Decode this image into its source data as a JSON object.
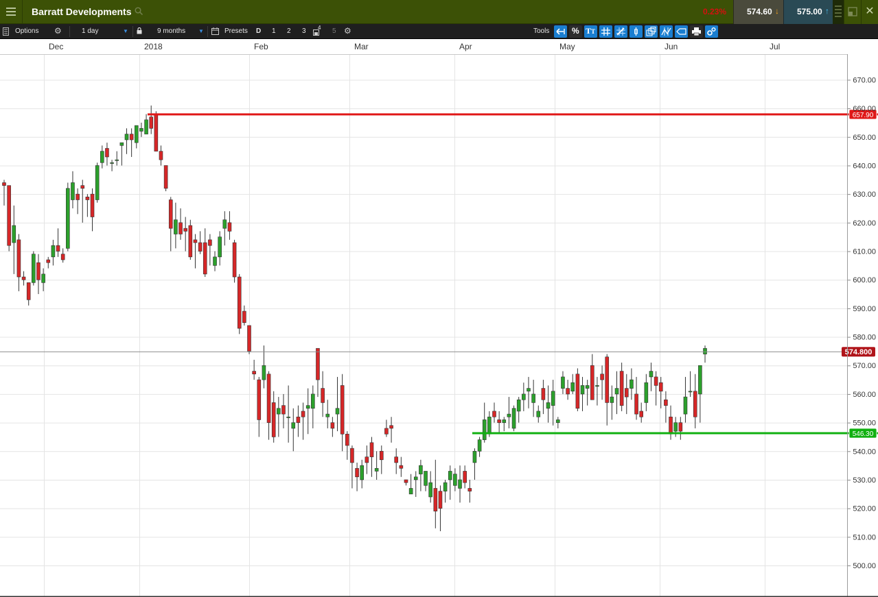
{
  "title_bar": {
    "menu_icon": "hamburger-menu-icon",
    "instrument": "Barratt Developments",
    "search_icon": "search-icon",
    "change_percent": "0.23%",
    "sell_price": "574.60",
    "buy_price": "575.00",
    "close_icon": "close-icon"
  },
  "toolbar": {
    "options_label": "Options",
    "interval": "1 day",
    "period": "9 months",
    "presets_label": "Presets",
    "preset_buttons": [
      "D",
      "1",
      "2",
      "3",
      "4",
      "5"
    ],
    "tools_label": "Tools"
  },
  "chart_data": {
    "type": "candlestick",
    "x_labels": [
      "Dec",
      "2018",
      "Feb",
      "Mar",
      "Apr",
      "May",
      "Jun",
      "Jul"
    ],
    "y_ticks": [
      "670.00",
      "660.00",
      "650.00",
      "640.00",
      "630.00",
      "620.00",
      "610.00",
      "600.00",
      "590.00",
      "580.00",
      "570.00",
      "560.00",
      "550.00",
      "540.00",
      "530.00",
      "520.00",
      "510.00",
      "500.00"
    ],
    "ylim": [
      495,
      685
    ],
    "grid": true,
    "up_color": "#2ca02c",
    "down_color": "#d62728",
    "current_price": {
      "value": 574.8,
      "label": "574.800"
    },
    "resistance": {
      "value": 657.9,
      "label": "657.90",
      "color": "#e01818"
    },
    "support": {
      "value": 546.3,
      "label": "546.30",
      "color": "#10b010"
    },
    "candles": [
      [
        634,
        635,
        626,
        633
      ],
      [
        633,
        633,
        610,
        612
      ],
      [
        613,
        626,
        602,
        619
      ],
      [
        614,
        616,
        596,
        601
      ],
      [
        601,
        603,
        598,
        600
      ],
      [
        599,
        599,
        591,
        593
      ],
      [
        599,
        610,
        598,
        609
      ],
      [
        606,
        609,
        595,
        600
      ],
      [
        599,
        604,
        596,
        602
      ],
      [
        607,
        608,
        604,
        606
      ],
      [
        608,
        614,
        605,
        612
      ],
      [
        612,
        618,
        608,
        610
      ],
      [
        609,
        611,
        606,
        607
      ],
      [
        611,
        634,
        610,
        632
      ],
      [
        628,
        638,
        625,
        634
      ],
      [
        630,
        632,
        623,
        628
      ],
      [
        633,
        635,
        620,
        632
      ],
      [
        629,
        630,
        622,
        628
      ],
      [
        630,
        632,
        617,
        622
      ],
      [
        628,
        641,
        627,
        640
      ],
      [
        641,
        647,
        639,
        645
      ],
      [
        646,
        648,
        640,
        643
      ],
      [
        641,
        642,
        638,
        641
      ],
      [
        642,
        645,
        640,
        642
      ],
      [
        647,
        647,
        640,
        648
      ],
      [
        649,
        653,
        644,
        651
      ],
      [
        651,
        653,
        643,
        649
      ],
      [
        648,
        650,
        646,
        654
      ],
      [
        652,
        655,
        650,
        653
      ],
      [
        651,
        658,
        652,
        656
      ],
      [
        657,
        661,
        651,
        653
      ],
      [
        658,
        659,
        646,
        645
      ],
      [
        645,
        647,
        640,
        642
      ],
      [
        640,
        640,
        631,
        632
      ],
      [
        628,
        629,
        610,
        618
      ],
      [
        616,
        627,
        611,
        621
      ],
      [
        620,
        625,
        614,
        616
      ],
      [
        618,
        622,
        610,
        617
      ],
      [
        619,
        621,
        607,
        608
      ],
      [
        614,
        616,
        604,
        613
      ],
      [
        613,
        617,
        609,
        610
      ],
      [
        613,
        618,
        601,
        602
      ],
      [
        614,
        616,
        605,
        612
      ],
      [
        605,
        610,
        603,
        608
      ],
      [
        608,
        617,
        605,
        615
      ],
      [
        618,
        624,
        612,
        621
      ],
      [
        620,
        624,
        614,
        617
      ],
      [
        613,
        614,
        599,
        601
      ],
      [
        601,
        602,
        581,
        583
      ],
      [
        589,
        591,
        584,
        585
      ],
      [
        584,
        584,
        574,
        575
      ],
      [
        568,
        572,
        565,
        567
      ],
      [
        565,
        566,
        545,
        551
      ],
      [
        565,
        577,
        562,
        570
      ],
      [
        567,
        568,
        544,
        550
      ],
      [
        557,
        561,
        543,
        545
      ],
      [
        553,
        559,
        545,
        555
      ],
      [
        556,
        560,
        548,
        553
      ],
      [
        552,
        563,
        543,
        552
      ],
      [
        548,
        555,
        540,
        550
      ],
      [
        552,
        556,
        545,
        550
      ],
      [
        554,
        557,
        544,
        552
      ],
      [
        555,
        562,
        546,
        556
      ],
      [
        555,
        563,
        548,
        560
      ],
      [
        576,
        576,
        559,
        565
      ],
      [
        562,
        568,
        552,
        557
      ],
      [
        552,
        558,
        548,
        553
      ],
      [
        550,
        552,
        545,
        548
      ],
      [
        553,
        566,
        547,
        555
      ],
      [
        563,
        567,
        540,
        546
      ],
      [
        546,
        547,
        537,
        542
      ],
      [
        541,
        542,
        527,
        536
      ],
      [
        534,
        536,
        526,
        531
      ],
      [
        530,
        537,
        527,
        535
      ],
      [
        538,
        542,
        532,
        536
      ],
      [
        543,
        545,
        531,
        538
      ],
      [
        533,
        540,
        530,
        534
      ],
      [
        540,
        542,
        532,
        537
      ],
      [
        548,
        551,
        545,
        546
      ],
      [
        549,
        552,
        543,
        548
      ],
      [
        538,
        541,
        532,
        536
      ],
      [
        535,
        538,
        531,
        534
      ],
      [
        530,
        530,
        528,
        529
      ],
      [
        525,
        532,
        526,
        527
      ],
      [
        530,
        533,
        524,
        531
      ],
      [
        532,
        537,
        526,
        535
      ],
      [
        528,
        530,
        526,
        533
      ],
      [
        524,
        533,
        522,
        529
      ],
      [
        527,
        537,
        513,
        519
      ],
      [
        526,
        528,
        512,
        520
      ],
      [
        526,
        530,
        522,
        529
      ],
      [
        530,
        535,
        523,
        533
      ],
      [
        528,
        534,
        526,
        532
      ],
      [
        527,
        535,
        522,
        530
      ],
      [
        533,
        535,
        527,
        529
      ],
      [
        527,
        530,
        522,
        526
      ],
      [
        536,
        541,
        530,
        540
      ],
      [
        540,
        545,
        538,
        544
      ],
      [
        544,
        557,
        543,
        551
      ],
      [
        546,
        554,
        545,
        552
      ],
      [
        554,
        557,
        550,
        552
      ],
      [
        551,
        554,
        546,
        550
      ],
      [
        550,
        552,
        547,
        551
      ],
      [
        552,
        559,
        548,
        553
      ],
      [
        548,
        556,
        547,
        555
      ],
      [
        554,
        559,
        550,
        558
      ],
      [
        558,
        564,
        554,
        560
      ],
      [
        561,
        566,
        555,
        562
      ],
      [
        557,
        565,
        552,
        560
      ],
      [
        552,
        556,
        550,
        554
      ],
      [
        562,
        565,
        553,
        558
      ],
      [
        555,
        563,
        550,
        557
      ],
      [
        556,
        565,
        549,
        561
      ],
      [
        550,
        552,
        548,
        551
      ],
      [
        562,
        568,
        560,
        566
      ],
      [
        562,
        565,
        558,
        560
      ],
      [
        561,
        567,
        560,
        564
      ],
      [
        567,
        569,
        554,
        555
      ],
      [
        560,
        566,
        554,
        563
      ],
      [
        562,
        565,
        556,
        563
      ],
      [
        570,
        574,
        559,
        558
      ],
      [
        563,
        566,
        556,
        563
      ],
      [
        567,
        570,
        558,
        565
      ],
      [
        573,
        574,
        549,
        557
      ],
      [
        557,
        563,
        551,
        559
      ],
      [
        560,
        568,
        553,
        562
      ],
      [
        568,
        571,
        554,
        556
      ],
      [
        562,
        567,
        553,
        559
      ],
      [
        562,
        569,
        558,
        565
      ],
      [
        560,
        566,
        551,
        553
      ],
      [
        554,
        557,
        550,
        552
      ],
      [
        557,
        567,
        554,
        564
      ],
      [
        566,
        571,
        561,
        568
      ],
      [
        566,
        568,
        556,
        563
      ],
      [
        564,
        566,
        555,
        561
      ],
      [
        558,
        561,
        550,
        556
      ],
      [
        552,
        556,
        544,
        546
      ],
      [
        547,
        552,
        545,
        550
      ],
      [
        550,
        552,
        544,
        547
      ],
      [
        553,
        566,
        550,
        559
      ],
      [
        561,
        568,
        559,
        561
      ],
      [
        561,
        567,
        548,
        552
      ],
      [
        560,
        566,
        550,
        570
      ],
      [
        574,
        577,
        571,
        576
      ]
    ]
  }
}
